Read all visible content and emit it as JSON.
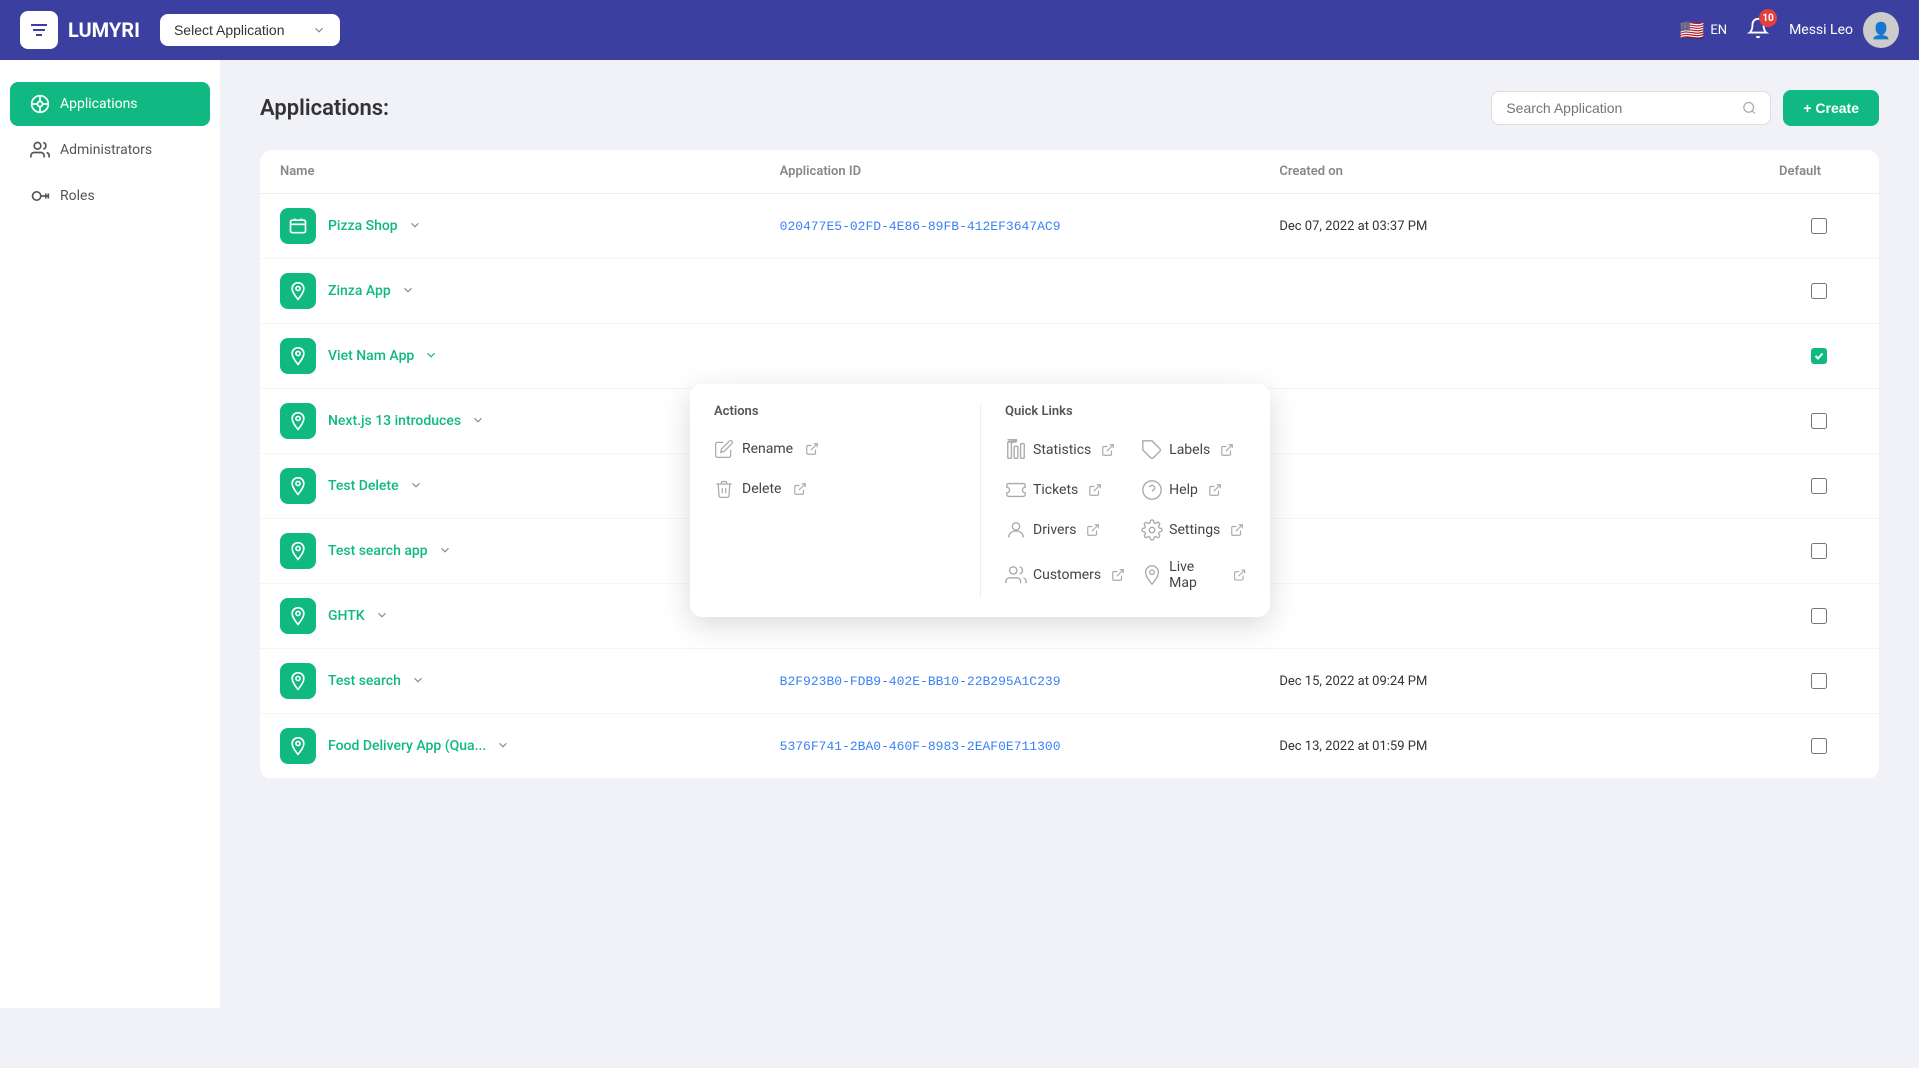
{
  "header": {
    "logo_text": "LUMYRI",
    "select_app_label": "Select Application",
    "lang": "EN",
    "notif_count": "10",
    "user_name": "Messi Leo"
  },
  "sidebar": {
    "items": [
      {
        "id": "applications",
        "label": "Applications",
        "active": true
      },
      {
        "id": "administrators",
        "label": "Administrators",
        "active": false
      },
      {
        "id": "roles",
        "label": "Roles",
        "active": false
      }
    ]
  },
  "page": {
    "title": "Applications:",
    "search_placeholder": "Search Application",
    "create_label": "+ Create"
  },
  "table": {
    "columns": [
      "Name",
      "Application ID",
      "Created on",
      "Default"
    ],
    "rows": [
      {
        "id": 1,
        "name": "Pizza Shop",
        "icon_type": "bus",
        "app_id": "020477E5-02FD-4E86-89FB-412EF3647AC9",
        "created_on": "Dec 07, 2022 at 03:37 PM",
        "default": false,
        "has_dropdown": true,
        "dropdown_open": false
      },
      {
        "id": 2,
        "name": "Zinza App",
        "icon_type": "location",
        "app_id": "",
        "created_on": "",
        "default": false,
        "has_dropdown": true,
        "dropdown_open": false
      },
      {
        "id": 3,
        "name": "Viet Nam App",
        "icon_type": "location",
        "app_id": "",
        "created_on": "",
        "default": true,
        "has_dropdown": true,
        "dropdown_open": true
      },
      {
        "id": 4,
        "name": "Next.js 13 introduces",
        "icon_type": "location",
        "app_id": "",
        "created_on": "",
        "default": false,
        "has_dropdown": true,
        "dropdown_open": false
      },
      {
        "id": 5,
        "name": "Test Delete",
        "icon_type": "location",
        "app_id": "",
        "created_on": "",
        "default": false,
        "has_dropdown": true,
        "dropdown_open": false
      },
      {
        "id": 6,
        "name": "Test search app",
        "icon_type": "location",
        "app_id": "",
        "created_on": "",
        "default": false,
        "has_dropdown": true,
        "dropdown_open": false
      },
      {
        "id": 7,
        "name": "GHTK",
        "icon_type": "location",
        "app_id": "",
        "created_on": "",
        "default": false,
        "has_dropdown": true,
        "dropdown_open": false
      },
      {
        "id": 8,
        "name": "Test search",
        "icon_type": "location",
        "app_id": "B2F923B0-FDB9-402E-BB10-22B295A1C239",
        "created_on": "Dec 15, 2022 at 09:24 PM",
        "default": false,
        "has_dropdown": true,
        "dropdown_open": false
      },
      {
        "id": 9,
        "name": "Food Delivery App (Qua...",
        "icon_type": "location",
        "app_id": "5376F741-2BA0-460F-8983-2EAF0E711300",
        "created_on": "Dec 13, 2022 at 01:59 PM",
        "default": false,
        "has_dropdown": true,
        "dropdown_open": false
      }
    ]
  },
  "dropdown": {
    "actions_title": "Actions",
    "quick_links_title": "Quick Links",
    "actions": [
      {
        "label": "Rename",
        "icon": "rename"
      },
      {
        "label": "Delete",
        "icon": "delete"
      }
    ],
    "quick_links": [
      {
        "label": "Statistics",
        "icon": "statistics"
      },
      {
        "label": "Tickets",
        "icon": "tickets"
      },
      {
        "label": "Labels",
        "icon": "labels"
      },
      {
        "label": "Drivers",
        "icon": "drivers"
      },
      {
        "label": "Help",
        "icon": "help"
      },
      {
        "label": "Customers",
        "icon": "customers"
      },
      {
        "label": "Settings",
        "icon": "settings"
      },
      {
        "label": "Live Map",
        "icon": "map"
      }
    ]
  }
}
